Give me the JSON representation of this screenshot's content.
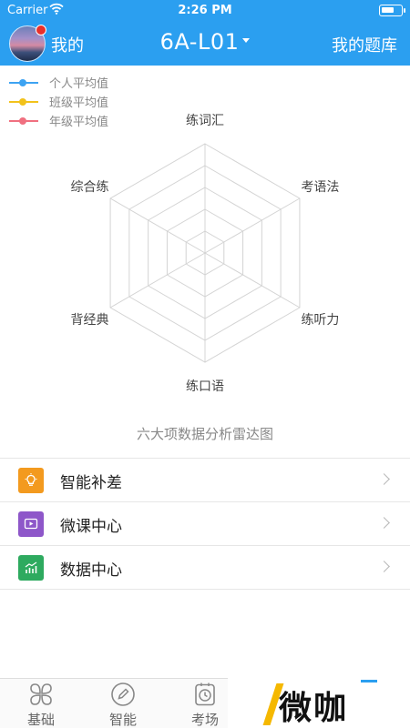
{
  "status_bar": {
    "carrier": "Carrier",
    "time": "2:26 PM",
    "battery_level": 0.65
  },
  "nav": {
    "left_label": "我的",
    "title": "6A-L01",
    "right_label": "我的题库"
  },
  "legend": [
    {
      "label": "个人平均值",
      "color": "#3da3f2"
    },
    {
      "label": "班级平均值",
      "color": "#f2c21b"
    },
    {
      "label": "年级平均值",
      "color": "#f07080"
    }
  ],
  "chart_data": {
    "type": "radar",
    "axes": [
      "练词汇",
      "考语法",
      "练听力",
      "练口语",
      "背经典",
      "综合练"
    ],
    "series": [],
    "grid_rings": 5,
    "caption": "六大项数据分析雷达图"
  },
  "menu": [
    {
      "label": "智能补差",
      "icon": "lightbulb-icon",
      "color": "#f39a1f"
    },
    {
      "label": "微课中心",
      "icon": "video-icon",
      "color": "#8e57c9"
    },
    {
      "label": "数据中心",
      "icon": "bar-chart-icon",
      "color": "#2eaa5f"
    }
  ],
  "tabs": [
    {
      "label": "基础",
      "icon": "clover-icon"
    },
    {
      "label": "智能",
      "icon": "pencil-icon"
    },
    {
      "label": "考场",
      "icon": "clock-icon"
    }
  ],
  "watermark": {
    "text": "微咖"
  }
}
